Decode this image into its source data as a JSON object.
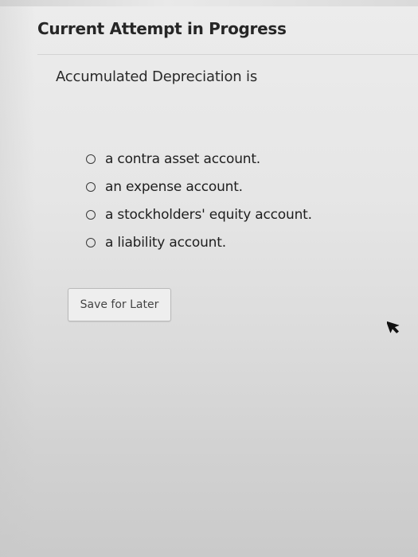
{
  "header": {
    "title": "Current Attempt in Progress"
  },
  "question": {
    "text": "Accumulated Depreciation is",
    "options": [
      {
        "label": "a contra asset account.",
        "selected": false
      },
      {
        "label": "an expense account.",
        "selected": false
      },
      {
        "label": "a stockholders' equity account.",
        "selected": false
      },
      {
        "label": "a liability account.",
        "selected": false
      }
    ]
  },
  "actions": {
    "save_label": "Save for Later"
  },
  "icons": {
    "radio": "radio-unchecked-icon",
    "pointer": "mouse-pointer-icon"
  },
  "colors": {
    "background": "#e6e6e6",
    "text": "#1f1f1f",
    "button_border": "#b9b9b9"
  }
}
